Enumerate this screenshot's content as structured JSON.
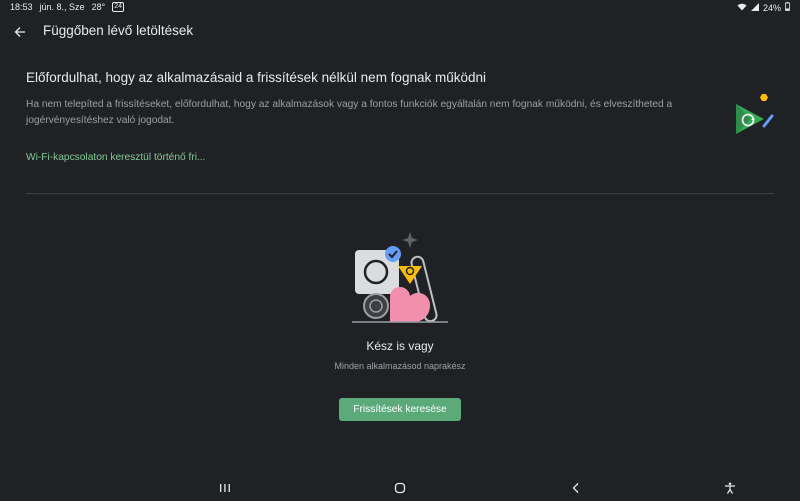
{
  "status_bar": {
    "time": "18:53",
    "date": "jún. 8., Sze",
    "temp": "28°",
    "badge": "24",
    "battery": "24%"
  },
  "app_bar": {
    "title": "Függőben lévő letöltések"
  },
  "warning": {
    "title": "Előfordulhat, hogy az alkalmazásaid a frissítések nélkül nem fognak működni",
    "body": "Ha nem telepíted a frissítéseket, előfordulhat, hogy az alkalmazások vagy a fontos funkciók egyáltalán nem fognak működni, és elveszítheted a jogérvényesítéshez való jogodat.",
    "wifi_link": "Wi-Fi-kapcsolaton keresztül történő fri..."
  },
  "empty_state": {
    "title": "Kész is vagy",
    "subtitle": "Minden alkalmazásod naprakész",
    "button": "Frissítések keresése"
  },
  "colors": {
    "background": "#202124",
    "accent_green": "#81c995",
    "button_green": "#5bab7a"
  },
  "icons": {
    "back": "arrow-back-icon",
    "wifi": "wifi-icon",
    "signal": "signal-icon",
    "battery": "battery-icon",
    "nav_recents": "recents-icon",
    "nav_home": "home-icon",
    "nav_back": "nav-back-icon",
    "accessibility": "accessibility-icon"
  }
}
